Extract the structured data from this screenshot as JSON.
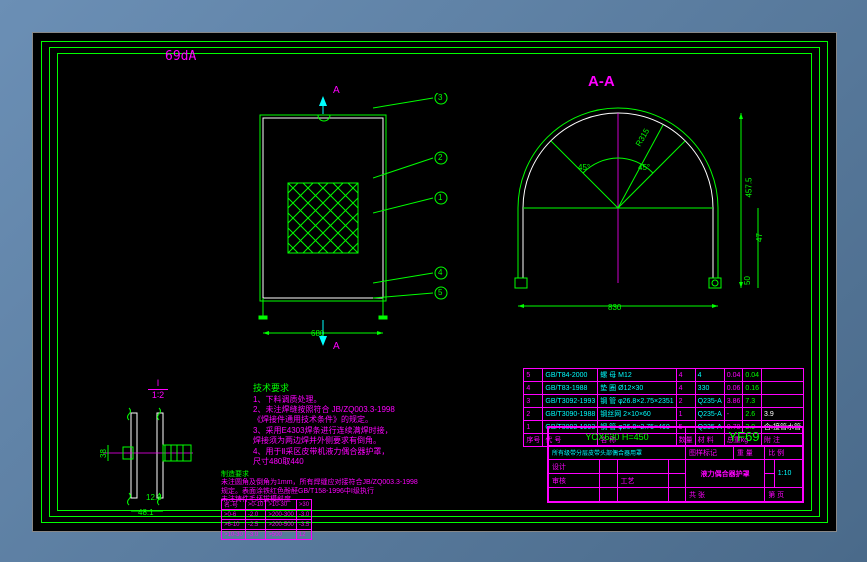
{
  "top_label": "69dA",
  "section_aa": "A-A",
  "arrow_a_top": "A",
  "arrow_a_bot": "A",
  "scale_i": {
    "label": "I",
    "ratio": "1∶2"
  },
  "balloons": {
    "b1": "1",
    "b2": "2",
    "b3": "3",
    "b4": "4",
    "b5": "5"
  },
  "dims": {
    "front_w": "680",
    "section_w": "830",
    "section_r": "R315",
    "section_h": "457.5",
    "section_top": "47",
    "ang45a": "45°",
    "ang45b": "45°",
    "detail_w": "48.1",
    "detail_h": "38",
    "detail_x": "12.8",
    "detail_y": "50"
  },
  "notes": {
    "title": "技术要求",
    "n1": "1、下料调质处理。",
    "n2": "2、未注焊缝按照符合 JB/ZQ003.3-1998",
    "n2b": "   《焊接件通用技术条件》的规定。",
    "n3": "3、采用E4303焊条进行连续满焊时接，",
    "n3b": "   焊接须为两边焊并外侧要求有倒角。",
    "n4": "4、用于Ⅱ采区皮带机液力偶合器护罩，",
    "n4b": "   尺寸480取440"
  },
  "mfg": {
    "title": "制造要求",
    "l1": "未注圆角及倒角为1mm，所有焊缝应对接符合JB/ZQ003.3-1998",
    "l2": "规定。表面涂铁红色酚醛GB/T158-1996中Ⅰ级执行",
    "l3": "未注铸件毛坯拔模斜度"
  },
  "weld_table": {
    "h": [
      "名-号",
      ">0-10",
      ">10-30",
      ">30"
    ],
    "r1": [
      ">0-6",
      "-2.0",
      ">200-300",
      "-3.0"
    ],
    "r2": [
      ">6-10",
      "-2.5",
      ">200-500",
      "-3.5"
    ],
    "r3": [
      ">10-30",
      "-3.0",
      ">500",
      "12"
    ]
  },
  "bom": {
    "headers": [
      "序号",
      "代 号",
      "名 称",
      "数量",
      "材 料",
      "单重",
      "总重kg",
      "附 注"
    ],
    "rows": [
      {
        "n": "5",
        "std": "GB/T84-2000",
        "name": "螺 母 M12",
        "qty": "4",
        "mat": "4",
        "w1": "0.04",
        "w2": "0.04",
        "note": ""
      },
      {
        "n": "4",
        "std": "GB/T83-1988",
        "name": "垫 圈 Ø12×30",
        "qty": "4",
        "mat": "330",
        "w1": "0.06",
        "w2": "0.16",
        "note": ""
      },
      {
        "n": "3",
        "std": "GB/T3092-1993",
        "name": "钢 管 φ26.8×2.75×2351",
        "qty": "2",
        "mat": "Q235-A",
        "w1": "3.86",
        "w2": "7.3",
        "note": ""
      },
      {
        "n": "2",
        "std": "GB/T3090-1988",
        "name": "钢丝网 2×10×60",
        "qty": "1",
        "mat": "Q235-A",
        "w1": "-",
        "w2": "2.6",
        "note": "3.9"
      },
      {
        "n": "1",
        "std": "GB/T3092-1993",
        "name": "钢 管 φ26.8×2.75×460",
        "qty": "5",
        "mat": "Q235-A",
        "w1": "0.78",
        "w2": "3.9",
        "note": "含:接管水管"
      }
    ]
  },
  "title_block": {
    "params": "YOX630 H=450",
    "part_no": "YF69",
    "title": "液力偶合器护罩",
    "scale": "1:10",
    "h_drawmark": "图样标记",
    "h_weight": "重 量",
    "h_scale": "比 例",
    "h_page": "共  张",
    "h_pageno": "第  页",
    "r_design": "设计",
    "r_check": "审核",
    "r_proc": "工艺",
    "usage": "所有级带分层皮带头部偶合器用罩"
  }
}
